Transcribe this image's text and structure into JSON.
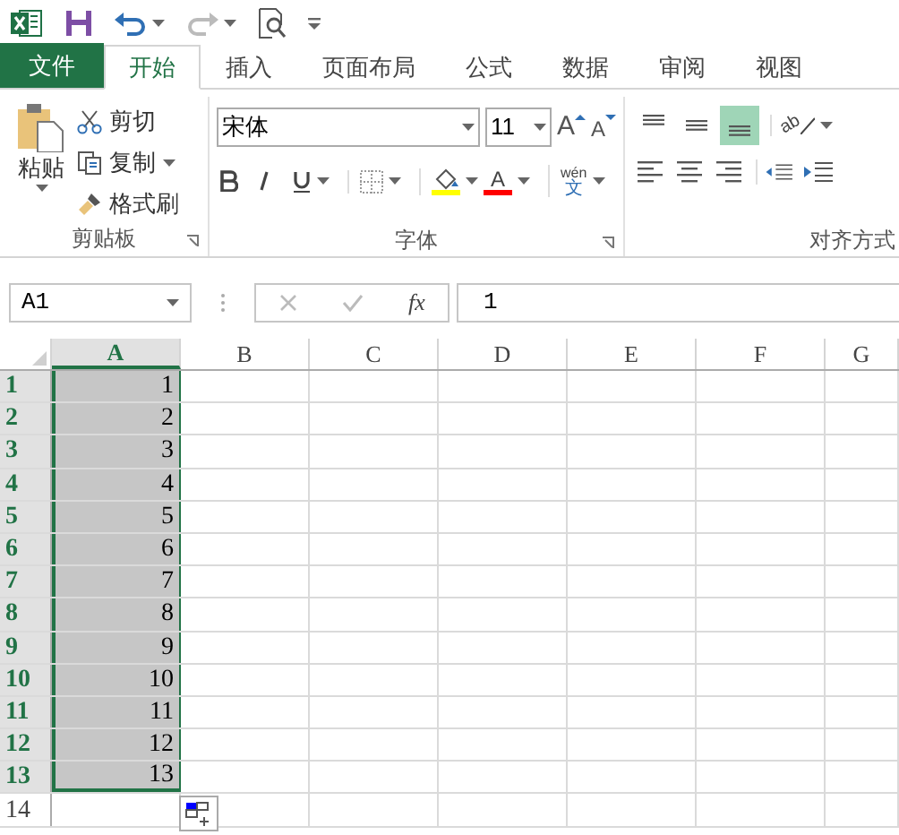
{
  "tabs": [
    {
      "label": "文件",
      "kind": "file",
      "selected": false
    },
    {
      "label": "开始",
      "kind": "tab",
      "selected": true
    },
    {
      "label": "插入",
      "kind": "tab",
      "selected": false
    },
    {
      "label": "页面布局",
      "kind": "tab",
      "selected": false
    },
    {
      "label": "公式",
      "kind": "tab",
      "selected": false
    },
    {
      "label": "数据",
      "kind": "tab",
      "selected": false
    },
    {
      "label": "审阅",
      "kind": "tab",
      "selected": false
    },
    {
      "label": "视图",
      "kind": "tab",
      "selected": false
    }
  ],
  "clipboard": {
    "paste": "粘贴",
    "cut": "剪切",
    "copy": "复制",
    "format_painter": "格式刷",
    "label": "剪贴板"
  },
  "font": {
    "name": "宋体",
    "size": "11",
    "grow_glyph": "A",
    "shrink_glyph": "A",
    "color_glyph": "A",
    "phonetic_top": "wén",
    "phonetic_bottom": "文",
    "label": "字体"
  },
  "alignment": {
    "orientation_glyph": "ab",
    "vertical": [
      {
        "selected": false
      },
      {
        "selected": false
      },
      {
        "selected": true
      }
    ],
    "label": "对齐方式"
  },
  "formula_bar": {
    "name_box": "A1",
    "fx": "fx",
    "value": "1"
  },
  "columns": [
    {
      "label": "A",
      "selected": true
    },
    {
      "label": "B",
      "selected": false
    },
    {
      "label": "C",
      "selected": false
    },
    {
      "label": "D",
      "selected": false
    },
    {
      "label": "E",
      "selected": false
    },
    {
      "label": "F",
      "selected": false
    },
    {
      "label": "G",
      "selected": false
    }
  ],
  "rows": [
    {
      "number": "1",
      "value": "1",
      "selected": true
    },
    {
      "number": "2",
      "value": "2",
      "selected": true
    },
    {
      "number": "3",
      "value": "3",
      "selected": true
    },
    {
      "number": "4",
      "value": "4",
      "selected": true
    },
    {
      "number": "5",
      "value": "5",
      "selected": true
    },
    {
      "number": "6",
      "value": "6",
      "selected": true
    },
    {
      "number": "7",
      "value": "7",
      "selected": true
    },
    {
      "number": "8",
      "value": "8",
      "selected": true
    },
    {
      "number": "9",
      "value": "9",
      "selected": true
    },
    {
      "number": "10",
      "value": "10",
      "selected": true
    },
    {
      "number": "11",
      "value": "11",
      "selected": true
    },
    {
      "number": "12",
      "value": "12",
      "selected": true
    },
    {
      "number": "13",
      "value": "13",
      "selected": true
    },
    {
      "number": "14",
      "value": "",
      "selected": false
    }
  ]
}
